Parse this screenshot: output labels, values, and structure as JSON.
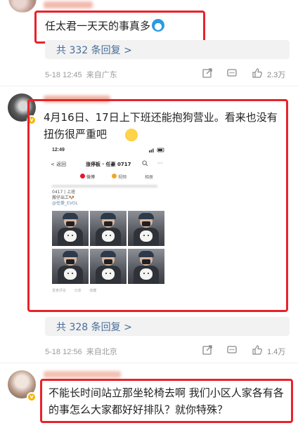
{
  "comments": [
    {
      "text": "任太君一天天的事真多",
      "replies_label": "共 332 条回复 >",
      "date": "5-18 12:45",
      "location": "来自广东",
      "likes": "2.3万"
    },
    {
      "text": "4月16日、17日上下班还能抱狗营业。看来也没有扭伤很严重吧",
      "replies_label": "共 328 条回复 >",
      "date": "5-18 12:56",
      "location": "来自北京",
      "likes": "1.4万",
      "embedded": {
        "time": "12:49",
        "back": "< 返回",
        "title": "涨停板 · 任豪 0717",
        "tabs": [
          "微博",
          "视频",
          "相册"
        ],
        "post_line1": "0417 | 上班",
        "post_line2": "搬仔出工🐶",
        "post_line3": "@任豪_EVOL",
        "footer": [
          "发表评论",
          "分享",
          "收藏"
        ]
      }
    },
    {
      "text": "不能长时间站立那坐轮椅去啊 我们小区人家各有各的事怎么大家都好好排队？就你特殊？"
    }
  ],
  "colors": {
    "highlight": "#e8232b",
    "link": "#486d9a",
    "verified": "#f7b500"
  }
}
